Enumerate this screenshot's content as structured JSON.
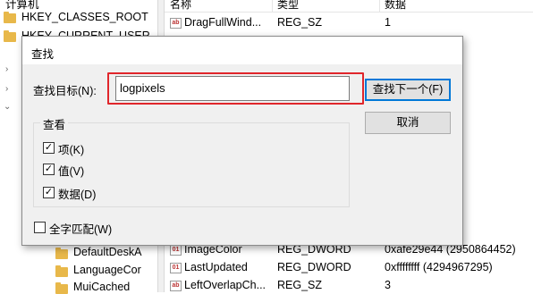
{
  "registry": {
    "tree_header": "计算机",
    "tree_items": [
      "HKEY_CLASSES_ROOT",
      "HKEY_CURRENT_USER",
      "DefaultDeskA",
      "LanguageCor",
      "MuiCached"
    ],
    "columns": [
      "名称",
      "类型",
      "数据"
    ],
    "values": [
      {
        "name": "DragFullWind...",
        "type": "REG_SZ",
        "data": "1"
      },
      {
        "name": "ImageColor",
        "type": "REG_DWORD",
        "data": "0xafe29e44 (2950864452)"
      },
      {
        "name": "LastUpdated",
        "type": "REG_DWORD",
        "data": "0xffffffff (4294967295)"
      },
      {
        "name": "LeftOverlapCh...",
        "type": "REG_SZ",
        "data": "3"
      }
    ]
  },
  "find_dialog": {
    "title": "查找",
    "target_label": "查找目标(N):",
    "search_value": "logpixels",
    "find_next_label": "查找下一个(F)",
    "cancel_label": "取消",
    "look_at_label": "查看",
    "options": [
      {
        "label": "项(K)",
        "checked": true
      },
      {
        "label": "值(V)",
        "checked": true
      },
      {
        "label": "数据(D)",
        "checked": true
      }
    ],
    "match_whole_label": "全字匹配(W)",
    "match_whole_checked": false,
    "highlight_color": "#e0262b"
  }
}
